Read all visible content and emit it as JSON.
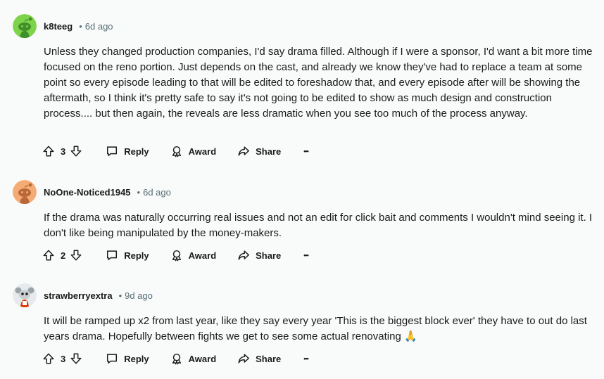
{
  "comments": [
    {
      "author": "k8teeg",
      "age": "6d ago",
      "body": "Unless they changed production companies, I'd say drama filled. Although if I were a sponsor, I'd want a bit more time focused on the reno portion. Just depends on the cast, and already we know they've had to replace a team at some point so every episode leading to that will be edited to foreshadow that, and every episode after will be showing the aftermath, so I think it's pretty safe to say it's not going to be edited to show as much design and construction process.... but then again, the reveals are less dramatic when you see too much of the process anyway.",
      "votes": "3",
      "avatar_color": "#7ed34a"
    },
    {
      "author": "NoOne-Noticed1945",
      "age": "6d ago",
      "body": "If the drama was naturally occurring real issues and not an edit for click bait and comments I wouldn't mind seeing it. I don't like being manipulated by the money-makers.",
      "votes": "2",
      "avatar_color": "#f5ab74"
    },
    {
      "author": "strawberryextra",
      "age": "9d ago",
      "body": "It will be ramped up x2 from last year, like they say every year 'This is the biggest block ever' they have to out do last years drama. Hopefully between fights we get to see some actual renovating 🙏",
      "votes": "3",
      "avatar_color": "#e7eaec"
    }
  ],
  "actions": {
    "reply": "Reply",
    "award": "Award",
    "share": "Share",
    "more": "•••"
  },
  "icons": {
    "upvote": "upvote-icon",
    "downvote": "downvote-icon",
    "reply": "comment-bubble-icon",
    "award": "award-icon",
    "share": "share-arrow-icon",
    "more": "more-options-icon"
  }
}
